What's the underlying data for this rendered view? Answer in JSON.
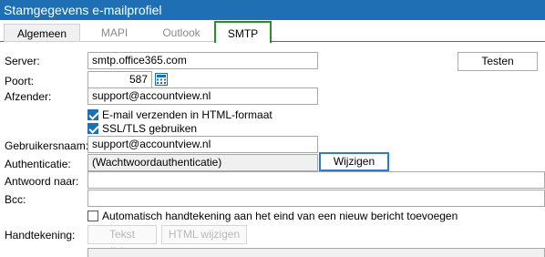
{
  "window": {
    "title": "Stamgegevens e-mailprofiel"
  },
  "tabs": [
    {
      "label": "Algemeen"
    },
    {
      "label": "MAPI"
    },
    {
      "label": "Outlook"
    },
    {
      "label": "SMTP"
    }
  ],
  "form": {
    "server_label": "Server:",
    "server_value": "smtp.office365.com",
    "poort_label": "Poort:",
    "poort_value": "587",
    "afzender_label": "Afzender:",
    "afzender_value": "support@accountview.nl",
    "html_checkbox": "E-mail verzenden in HTML-formaat",
    "ssl_checkbox": "SSL/TLS gebruiken",
    "gebruikersnaam_label": "Gebruikersnaam:",
    "gebruikersnaam_value": "support@accountview.nl",
    "authenticatie_label": "Authenticatie:",
    "authenticatie_value": "(Wachtwoordauthenticatie)",
    "antwoord_label": "Antwoord naar:",
    "antwoord_value": "",
    "bcc_label": "Bcc:",
    "bcc_value": "",
    "auto_signature_checkbox": "Automatisch handtekening aan het eind van een nieuw bericht toevoegen",
    "handtekening_label": "Handtekening:"
  },
  "buttons": {
    "testen": "Testen",
    "wijzigen": "Wijzigen",
    "tekst_wijzigen": "Tekst wijzigen",
    "html_wijzigen": "HTML wijzigen"
  },
  "checkbox_states": {
    "html": true,
    "ssl": true,
    "auto_signature": false
  },
  "colors": {
    "titlebar": "#1f6fb4",
    "tab_accent": "#2e8b2e",
    "focus": "#2a7bd1"
  }
}
